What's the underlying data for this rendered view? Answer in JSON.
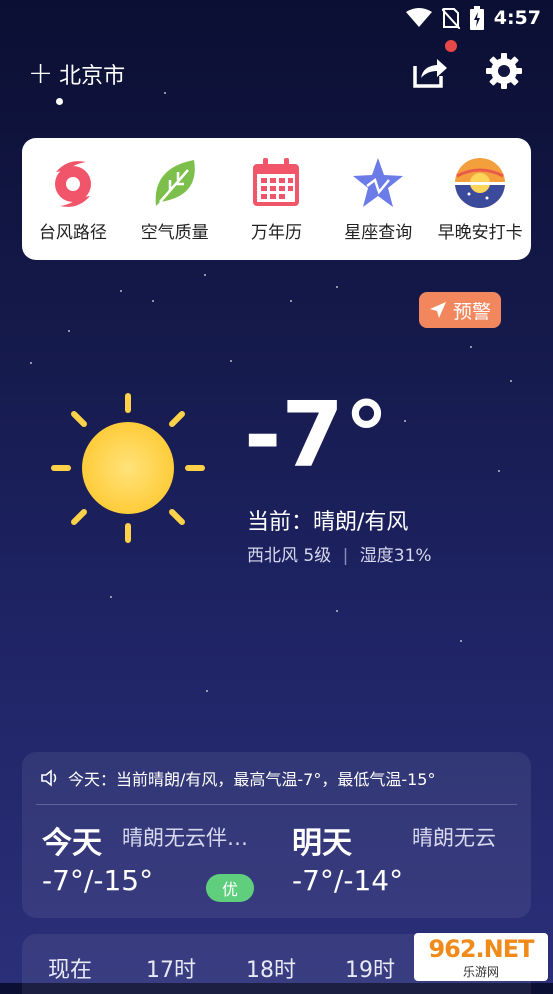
{
  "status_bar": {
    "time": "4:57",
    "icons": [
      "wifi-icon",
      "no-sim-icon",
      "battery-charging-icon"
    ]
  },
  "header": {
    "city": "北京市",
    "add_icon": "plus-icon",
    "share_icon": "share-icon",
    "settings_icon": "gear-icon"
  },
  "tools": [
    {
      "label": "台风路径",
      "icon": "typhoon-icon",
      "color": "#f0556a"
    },
    {
      "label": "空气质量",
      "icon": "leaf-icon",
      "color": "#7cc04b"
    },
    {
      "label": "万年历",
      "icon": "calendar-icon",
      "color": "#f0556a"
    },
    {
      "label": "星座查询",
      "icon": "star-icon",
      "color": "#6b7be8"
    },
    {
      "label": "早晚安打卡",
      "icon": "sunset-icon",
      "color": "#f3a03c"
    }
  ],
  "alert": {
    "label": "预警",
    "color": "#f2875e"
  },
  "current": {
    "temperature": "-7°",
    "condition": "当前：晴朗/有风",
    "wind": "西北风 5级",
    "humidity": "湿度31%"
  },
  "forecast": {
    "summary": "今天：当前晴朗/有风，最高气温-7°，最低气温-15°",
    "today": {
      "name": "今天",
      "condition": "晴朗无云伴…",
      "temp": "-7°/-15°",
      "aqi": "优"
    },
    "tomorrow": {
      "name": "明天",
      "condition": "晴朗无云",
      "temp": "-7°/-14°"
    }
  },
  "hourly": [
    "现在",
    "17时",
    "18时",
    "19时"
  ],
  "watermark": {
    "logo": "962.NET",
    "sub": "乐游网"
  }
}
